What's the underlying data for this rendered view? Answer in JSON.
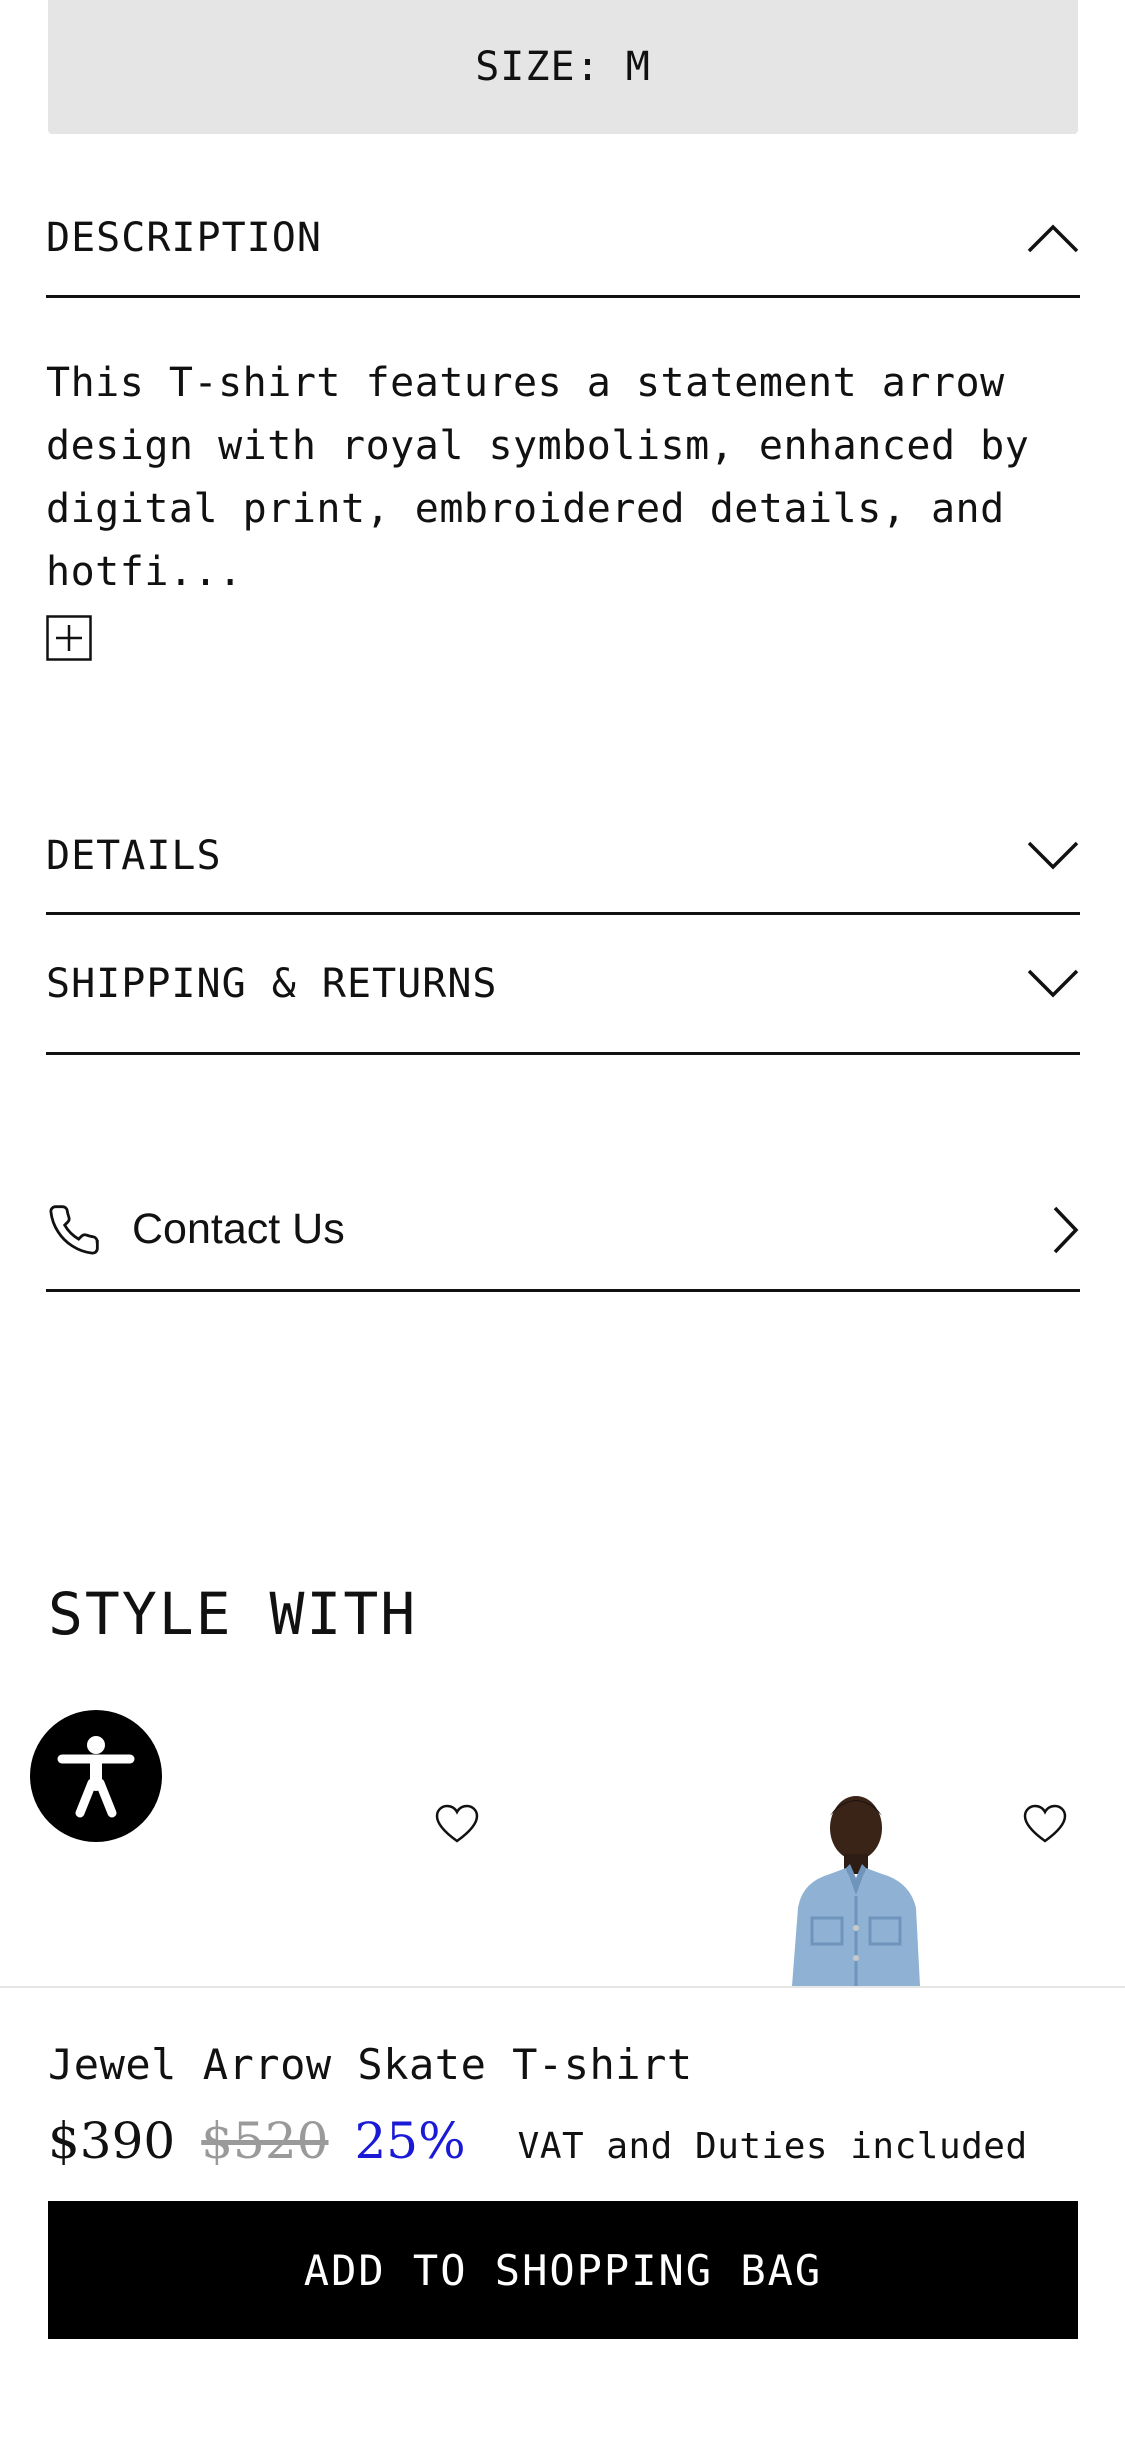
{
  "size_selector": {
    "label": "SIZE: M"
  },
  "accordions": {
    "description": {
      "title": "DESCRIPTION",
      "expanded": true
    },
    "details": {
      "title": "DETAILS",
      "expanded": false
    },
    "shipping": {
      "title": "SHIPPING & RETURNS",
      "expanded": false
    }
  },
  "description": {
    "lines": [
      "This T-shirt features a statement arrow",
      "design with royal symbolism, enhanced by",
      "digital print, embroidered details, and",
      "hotfi..."
    ],
    "expand_icon": "plus-square-icon"
  },
  "contact": {
    "label": "Contact Us",
    "icon": "phone-icon",
    "arrow_icon": "chevron-right-icon"
  },
  "style_with": {
    "heading": "STYLE WITH",
    "items": [
      {
        "wishlist_icon": "heart-icon"
      },
      {
        "wishlist_icon": "heart-icon",
        "image": "denim-jacket-model"
      }
    ]
  },
  "accessibility": {
    "icon": "accessibility-icon"
  },
  "product_bar": {
    "name": "Jewel Arrow Skate T-shirt",
    "price": "$390",
    "original_price": "$520",
    "discount": "25%",
    "tax_note": "VAT and Duties included",
    "cta_label": "ADD TO SHOPPING BAG",
    "colors": {
      "discount": "#1a1ad6",
      "cta_bg": "#000000"
    }
  }
}
